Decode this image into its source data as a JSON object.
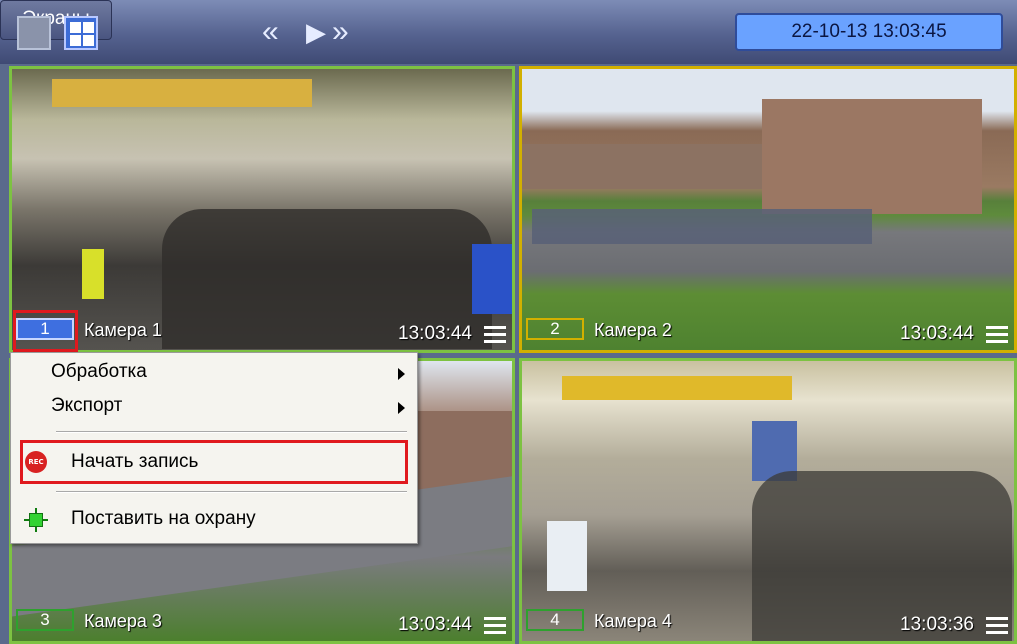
{
  "toolbar": {
    "screens_label": "Экраны",
    "nav_prev": "«",
    "nav_play": "▶",
    "nav_next": "»",
    "datetime": "22-10-13  13:03:45"
  },
  "cameras": [
    {
      "number": "1",
      "name": "Камера 1",
      "time": "13:03:44"
    },
    {
      "number": "2",
      "name": "Камера 2",
      "time": "13:03:44"
    },
    {
      "number": "3",
      "name": "Камера 3",
      "time": "13:03:44"
    },
    {
      "number": "4",
      "name": "Камера 4",
      "time": "13:03:36"
    }
  ],
  "context_menu": {
    "processing": "Обработка",
    "export": "Экспорт",
    "start_recording": "Начать запись",
    "arm": "Поставить на охрану",
    "rec_icon_text": "REC"
  },
  "colors": {
    "active_border": "#7dc242",
    "selected_border": "#d2b000",
    "highlight": "#e0191e",
    "datetime_bg": "#6aa2ff"
  }
}
